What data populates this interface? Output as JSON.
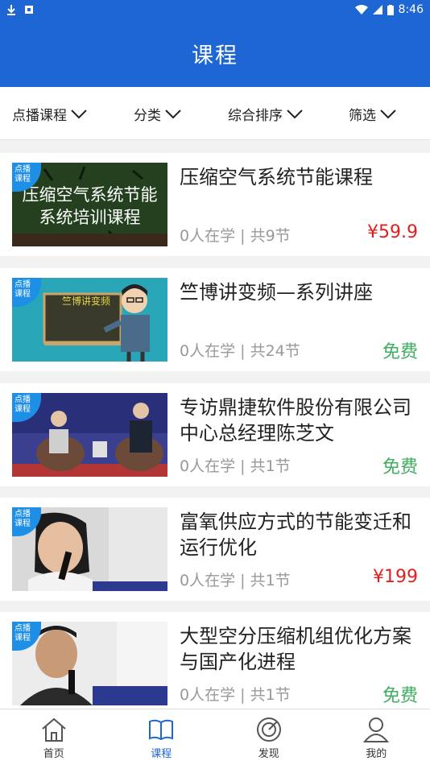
{
  "status": {
    "time": "8:46"
  },
  "header": {
    "title": "课程"
  },
  "filters": [
    {
      "label": "点播课程"
    },
    {
      "label": "分类"
    },
    {
      "label": "综合排序"
    },
    {
      "label": "筛选"
    }
  ],
  "courses": [
    {
      "tag_line1": "点播",
      "tag_line2": "课程",
      "thumb_line1": "压缩空气系统节能",
      "thumb_line2": "系统培训课程",
      "title": "压缩空气系统节能课程",
      "meta": "0人在学 | 共9节",
      "price": "¥59.9",
      "price_type": "paid"
    },
    {
      "tag_line1": "点播",
      "tag_line2": "课程",
      "thumb_board": "竺博讲变频",
      "title": "竺博讲变频—系列讲座",
      "meta": "0人在学 | 共24节",
      "price": "免费",
      "price_type": "free"
    },
    {
      "tag_line1": "点播",
      "tag_line2": "课程",
      "title": "专访鼎捷软件股份有限公司中心总经理陈芝文",
      "meta": "0人在学 | 共1节",
      "price": "免费",
      "price_type": "free"
    },
    {
      "tag_line1": "点播",
      "tag_line2": "课程",
      "title": "富氧供应方式的节能变迁和运行优化",
      "meta": "0人在学 | 共1节",
      "price": "¥199",
      "price_type": "paid"
    },
    {
      "tag_line1": "点播",
      "tag_line2": "课程",
      "title": "大型空分压缩机组优化方案与国产化进程",
      "meta": "0人在学 | 共1节",
      "price": "免费",
      "price_type": "free"
    }
  ],
  "tabs": [
    {
      "label": "首页",
      "icon": "home-icon"
    },
    {
      "label": "课程",
      "icon": "book-icon"
    },
    {
      "label": "发现",
      "icon": "discover-icon"
    },
    {
      "label": "我的",
      "icon": "user-icon"
    }
  ],
  "colors": {
    "primary": "#1e66d4",
    "paid": "#e02020",
    "free": "#3fae5f"
  }
}
